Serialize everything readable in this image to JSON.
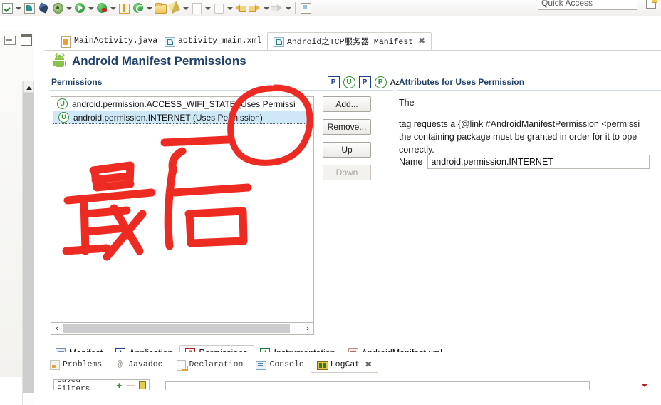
{
  "window": {
    "quick_access": {
      "placeholder": "Quick Access",
      "value": "Quick Access"
    }
  },
  "toolbar": {
    "items": [
      {
        "name": "save-all-icon",
        "glyph": "check-box"
      },
      {
        "name": "toolbar-dropdown-arrow",
        "glyph": "arrow"
      },
      {
        "name": "new-xml-icon",
        "glyph": "square"
      },
      {
        "name": "pen-icon",
        "glyph": "pen"
      },
      {
        "name": "debug-as-icon",
        "glyph": "bug"
      },
      {
        "name": "debug-dropdown-arrow",
        "glyph": "arrow"
      },
      {
        "name": "run-icon",
        "glyph": "run"
      },
      {
        "name": "run-dropdown-arrow",
        "glyph": "arrow"
      },
      {
        "name": "run-external-tools-icon",
        "glyph": "run-bug"
      },
      {
        "name": "run-external-dropdown-arrow",
        "glyph": "arrow"
      },
      {
        "name": "new-android-project-icon",
        "glyph": "gift"
      },
      {
        "name": "sdk-manager-icon",
        "glyph": "refresh"
      },
      {
        "name": "sdk-dropdown-arrow",
        "glyph": "arrow"
      },
      {
        "name": "open-resource-icon",
        "glyph": "folder"
      },
      {
        "name": "quick-fix-icon",
        "glyph": "wand"
      },
      {
        "name": "quick-fix-dropdown-arrow",
        "glyph": "arrow"
      },
      {
        "name": "next-annotation-icon",
        "glyph": "doc"
      },
      {
        "name": "next-annotation-dropdown-arrow",
        "glyph": "arrow"
      },
      {
        "name": "previous-annotation-icon",
        "glyph": "quote"
      },
      {
        "name": "previous-annotation-dropdown-arrow",
        "glyph": "arrow"
      },
      {
        "name": "back-icon",
        "glyph": "back"
      },
      {
        "name": "forward-icon",
        "glyph": "forward"
      },
      {
        "name": "forward-dropdown-arrow",
        "glyph": "arrow"
      },
      {
        "name": "next-edit-icon",
        "glyph": "grey-arrow"
      },
      {
        "name": "next-edit-dropdown-arrow",
        "glyph": "arrow"
      },
      {
        "name": "separator",
        "glyph": "sep"
      },
      {
        "name": "open-perspective-icon",
        "glyph": "perspective"
      }
    ],
    "new_perspective_label": "new-perspective-icon"
  },
  "left_stack": {
    "restore_label": "restore-view-icon",
    "maximize_label": "maximize-view-icon",
    "scroll_up_label": "scroll-up-arrow"
  },
  "editor": {
    "tabs": [
      {
        "label": "MainActivity.java",
        "icon": "java-file-icon",
        "active": false,
        "closeable": false
      },
      {
        "label": "activity_main.xml",
        "icon": "xml-file-icon",
        "active": false,
        "closeable": false
      },
      {
        "label": "Android之TCP服务器 Manifest",
        "icon": "xml-file-icon",
        "active": true,
        "closeable": true
      }
    ],
    "close_glyph": "✖",
    "page_title": "Android Manifest Permissions"
  },
  "permissions_section": {
    "title": "Permissions",
    "actions": [
      {
        "name": "add-permission-icon",
        "label": "P",
        "shape": "square"
      },
      {
        "name": "add-uses-permission-icon",
        "label": "U",
        "shape": "circle"
      },
      {
        "name": "add-permission-tree-icon",
        "label": "P",
        "shape": "square"
      },
      {
        "name": "add-permission-group-icon",
        "label": "P",
        "shape": "circle"
      },
      {
        "name": "sort-alphabetically-icon",
        "label": "Az",
        "shape": "text"
      }
    ],
    "list": [
      {
        "icon": "uses-permission-icon",
        "label": "android.permission.ACCESS_WIFI_STATE (Uses Permissi",
        "selected": false
      },
      {
        "icon": "uses-permission-icon",
        "label": "android.permission.INTERNET (Uses Permission)",
        "selected": true
      }
    ],
    "buttons": [
      {
        "label": "Add...",
        "name": "add-button",
        "enabled": true
      },
      {
        "label": "Remove...",
        "name": "remove-button",
        "enabled": true
      },
      {
        "label": "Up",
        "name": "up-button",
        "enabled": true
      },
      {
        "label": "Down",
        "name": "down-button",
        "enabled": false
      }
    ],
    "scroll_left": "‹",
    "scroll_right": "›"
  },
  "attributes_section": {
    "title": "Attributes for Uses Permission",
    "description_line1": "The",
    "description_line2": " tag requests a {@link #AndroidManifestPermission <permissi",
    "description_line3": "the containing package must be granted in order for it to ope",
    "description_line4": "correctly.",
    "name_label": "Name",
    "name_value": "android.permission.INTERNET"
  },
  "form_tabs": [
    {
      "label": "Manifest",
      "icon": "manifest-icon",
      "active": false
    },
    {
      "label": "Application",
      "icon": "application-icon",
      "active": false
    },
    {
      "label": "Permissions",
      "icon": "permissions-icon",
      "active": true
    },
    {
      "label": "Instrumentation",
      "icon": "instrumentation-icon",
      "active": false
    },
    {
      "label": "AndroidManifest.xml",
      "icon": "xml-source-icon",
      "active": false
    }
  ],
  "view_tabs": [
    {
      "label": "Problems",
      "icon": "problems-icon",
      "active": false,
      "closeable": false
    },
    {
      "label": "Javadoc",
      "icon": "javadoc-icon",
      "active": false,
      "closeable": false
    },
    {
      "label": "Declaration",
      "icon": "declaration-icon",
      "active": false,
      "closeable": false
    },
    {
      "label": "Console",
      "icon": "console-icon",
      "active": false,
      "closeable": false
    },
    {
      "label": "LogCat",
      "icon": "logcat-icon",
      "active": true,
      "closeable": true
    }
  ],
  "logcat": {
    "saved_filters_label": "Saved Filters",
    "add_filter_glyph": "+",
    "remove_filter_glyph": "—",
    "close_glyph": "✖"
  },
  "annotation": {
    "type": "handwritten-red-ink",
    "text": "最后",
    "meaning_note": "circle around selected INTERNET permission row",
    "color": "#ee2b22"
  }
}
